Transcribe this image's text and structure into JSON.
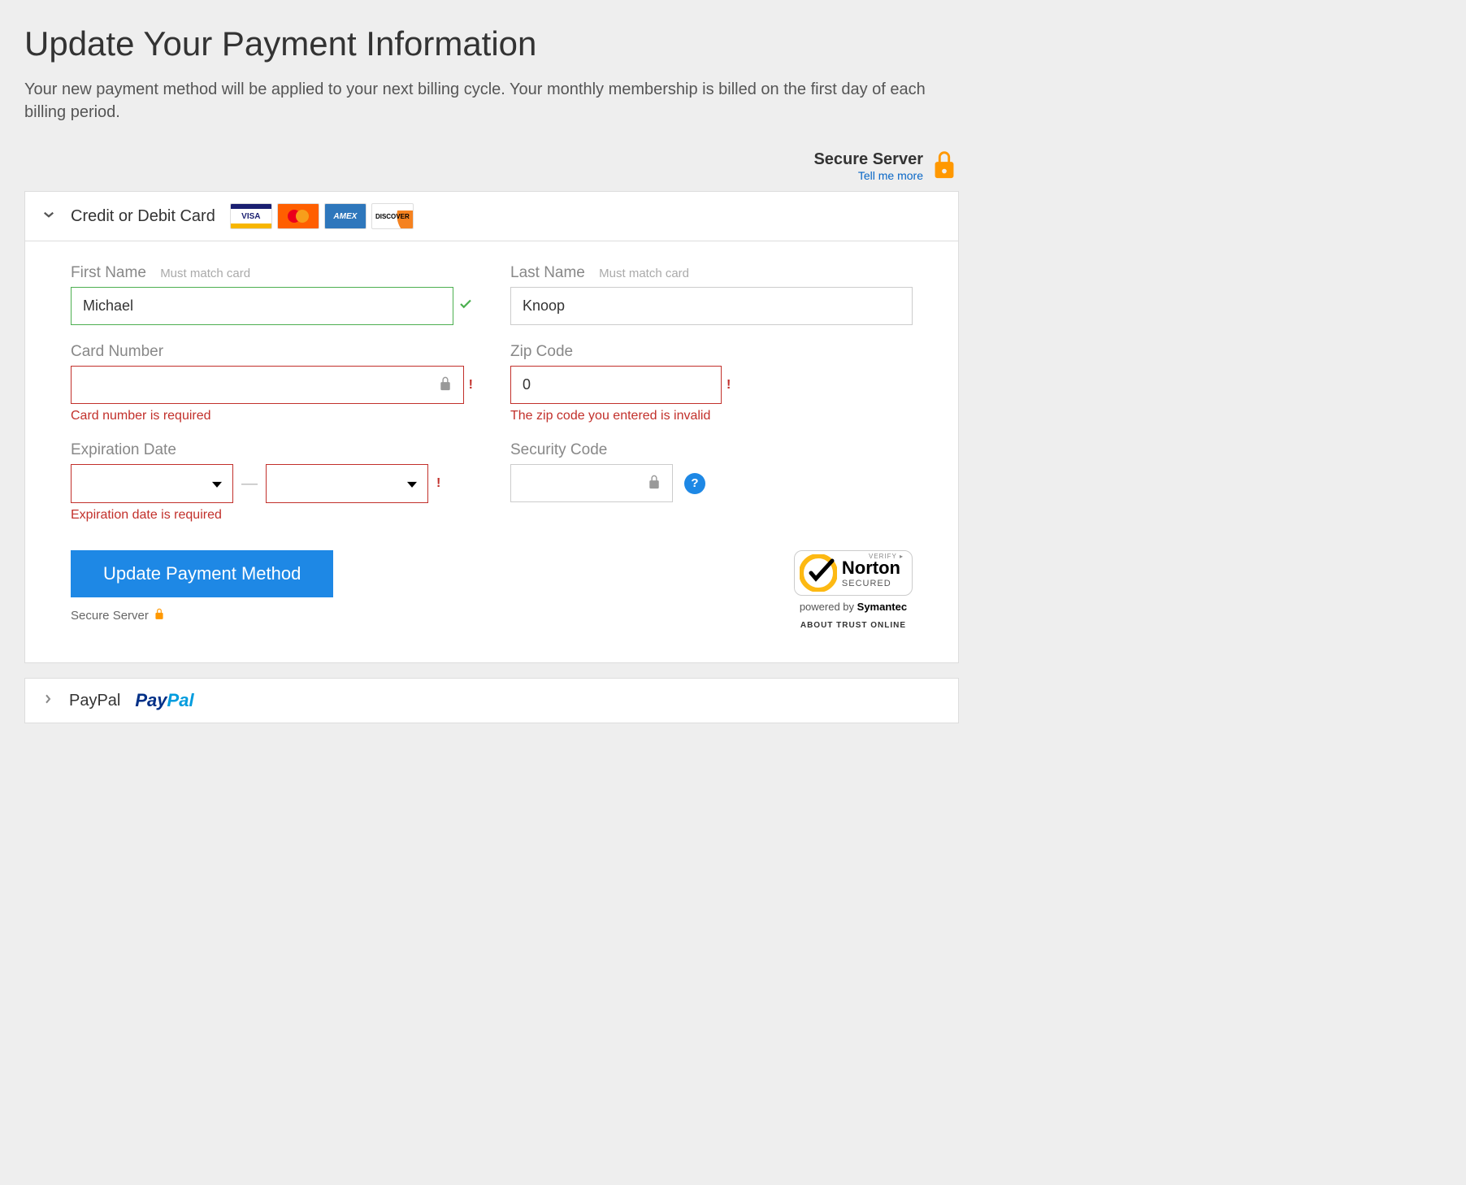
{
  "page": {
    "title": "Update Your Payment Information",
    "subtitle": "Your new payment method will be applied to your next billing cycle. Your monthly membership is billed on the first day of each billing period."
  },
  "secure_header": {
    "label": "Secure Server",
    "link": "Tell me more"
  },
  "card_panel": {
    "title": "Credit or Debit Card",
    "logos": [
      "VISA",
      "MasterCard",
      "AMEX",
      "DISCOVER"
    ]
  },
  "fields": {
    "first_name": {
      "label": "First Name",
      "hint": "Must match card",
      "value": "Michael"
    },
    "last_name": {
      "label": "Last Name",
      "hint": "Must match card",
      "value": "Knoop"
    },
    "card_number": {
      "label": "Card Number",
      "value": "",
      "error": "Card number is required"
    },
    "zip": {
      "label": "Zip Code",
      "value": "0",
      "error": "The zip code you entered is invalid"
    },
    "exp": {
      "label": "Expiration Date",
      "error": "Expiration date is required",
      "separator": "—"
    },
    "security": {
      "label": "Security Code",
      "value": ""
    }
  },
  "submit_label": "Update Payment Method",
  "secure_footer": "Secure Server",
  "norton": {
    "verify": "VERIFY ▸",
    "name": "Norton",
    "secured": "SECURED",
    "powered": "powered by ",
    "vendor": "Symantec",
    "about": "ABOUT TRUST ONLINE"
  },
  "paypal_panel": {
    "title": "PayPal"
  }
}
